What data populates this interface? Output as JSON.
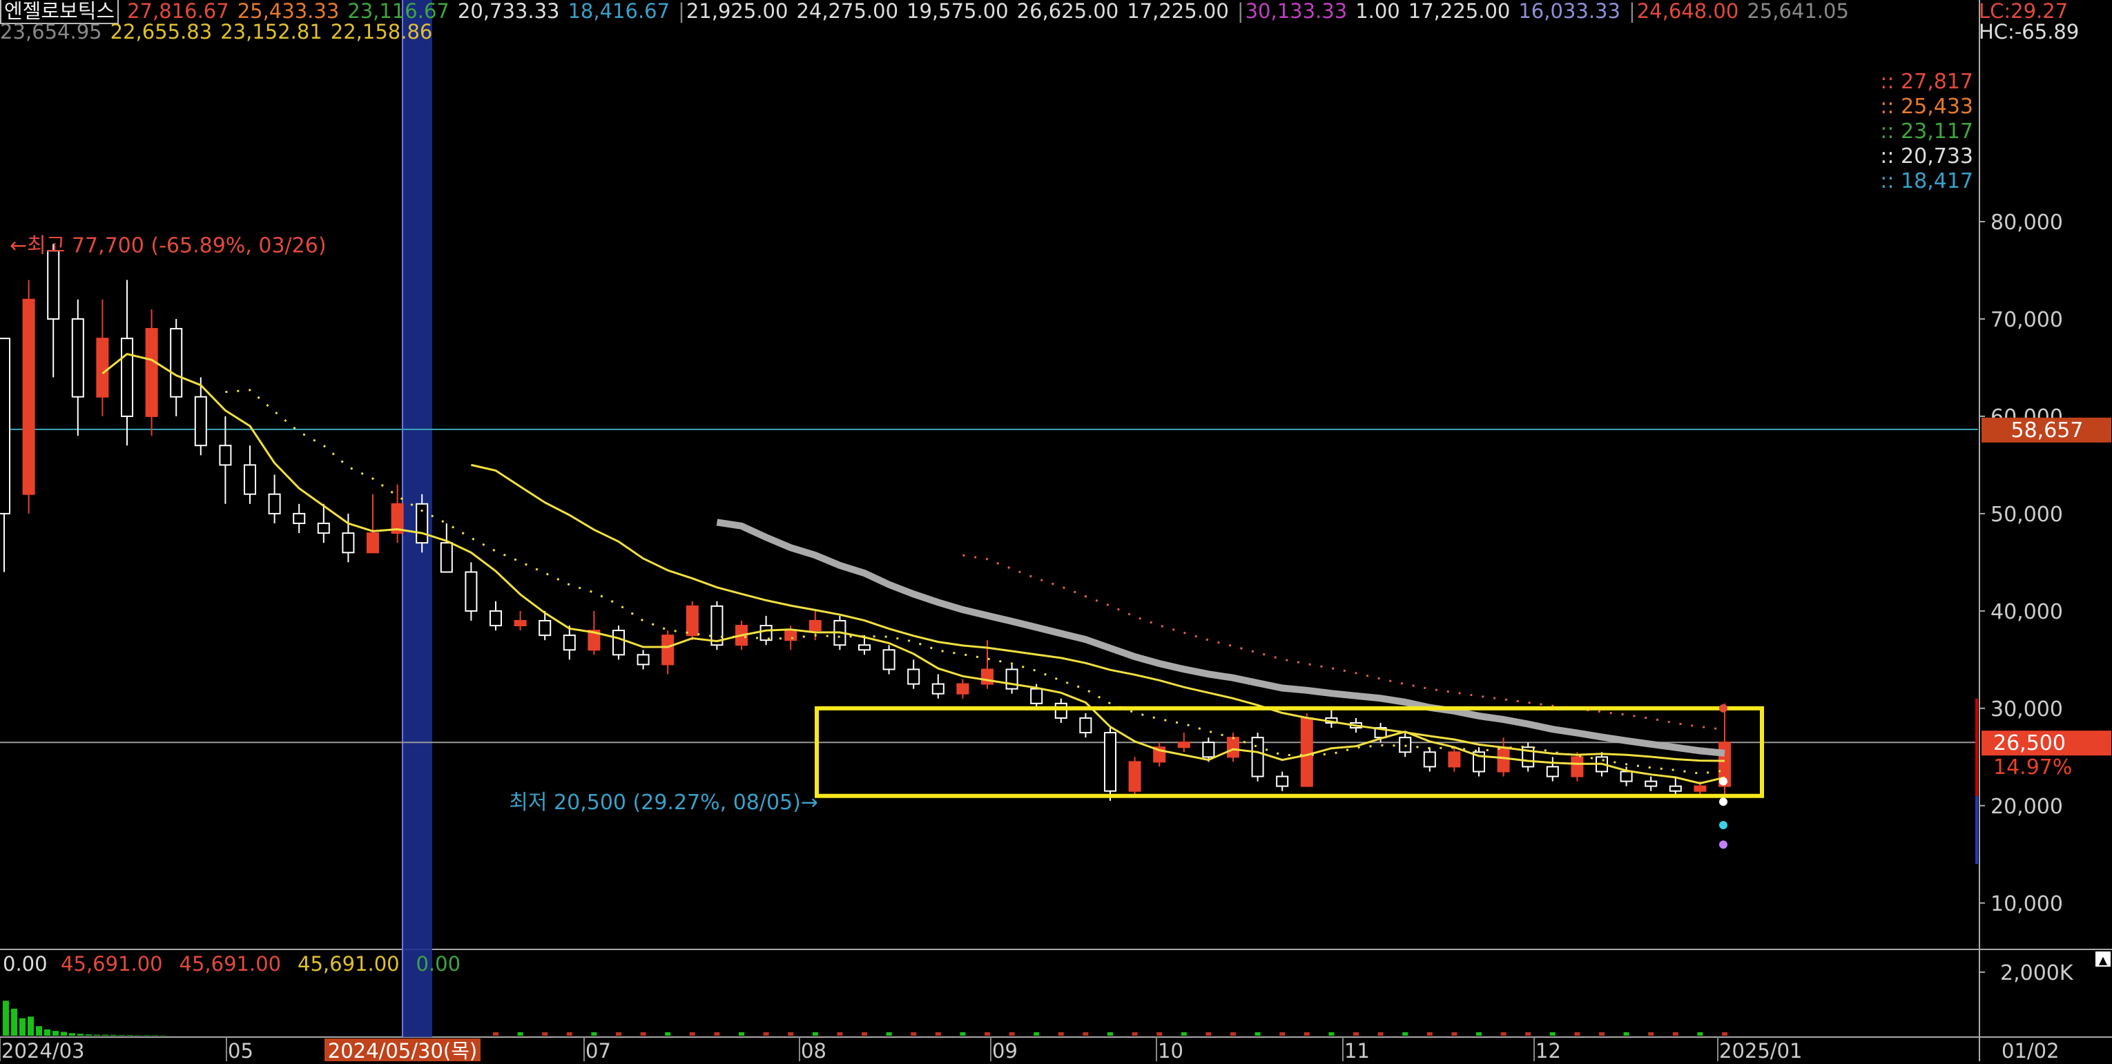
{
  "header": {
    "stock_name": "엔젤로보틱스",
    "row1_groups": [
      {
        "values": [
          "27,816.67",
          "25,433.33",
          "23,116.67",
          "20,733.33",
          "18,416.67"
        ],
        "colors": [
          "#e24a3a",
          "#e87a2a",
          "#3fa53f",
          "#dddddd",
          "#3aa0c8"
        ]
      },
      {
        "values": [
          "21,925.00",
          "24,275.00",
          "19,575.00",
          "26,625.00",
          "17,225.00"
        ],
        "colors": [
          "#dddddd",
          "#dddddd",
          "#dddddd",
          "#dddddd",
          "#dddddd"
        ]
      },
      {
        "values": [
          "30,133.33",
          "1.00",
          "17,225.00",
          "16,033.33"
        ],
        "colors": [
          "#c040c0",
          "#dddddd",
          "#dddddd",
          "#8f8fd8"
        ]
      },
      {
        "values": [
          "24,648.00",
          "25,641.05"
        ],
        "colors": [
          "#e24a3a",
          "#888888"
        ]
      }
    ],
    "row2_values": [
      "23,654.95",
      "22,655.83",
      "23,152.81",
      "22,158.86"
    ],
    "row2_colors": [
      "#888888",
      "#e0c030",
      "#e0c030",
      "#e0c030"
    ],
    "lc_label": "LC:29.27",
    "hc_label": "HC:-65.89"
  },
  "colors": {
    "up": "#e8412a",
    "down": "#ffffff",
    "ma_yellow": "#f0e040",
    "highlight_box": "#f7e81c",
    "hline_cyan": "#3aa7b8",
    "price_tag": "#c0431c",
    "current_tag": "#e8412a",
    "selection": "#1c2e8c"
  },
  "chart_data": {
    "type": "candlestick",
    "title": "",
    "xlabel": "",
    "ylabel": "",
    "ylim": [
      8000,
      90000
    ],
    "y_ticks": [
      "10,000",
      "20,000",
      "30,000",
      "40,000",
      "50,000",
      "60,000",
      "70,000",
      "80,000"
    ],
    "x_tick_labels": [
      "2024/03",
      "05",
      "07",
      "08",
      "09",
      "10",
      "11",
      "12",
      "2025/01"
    ],
    "selected_date": "2024/05/30(목)",
    "right_axis_date": "01/02",
    "annotations": {
      "high": "최고 77,700 (-65.89%, 03/26)",
      "low": "최저 20,500 (29.27%, 08/05)"
    },
    "legend_values": [
      "27,817",
      "25,433",
      "23,117",
      "20,733",
      "18,417"
    ],
    "legend_colors": [
      "#e24a3a",
      "#e87a2a",
      "#3fa53f",
      "#dddddd",
      "#3aa0c8"
    ],
    "price_tag": "58,657",
    "current_price": "26,500",
    "current_change": "14.97%",
    "horizontal_lines": [
      58657,
      26500
    ],
    "highlight_box": {
      "y_top": 30000,
      "y_bottom": 21000,
      "date_start": "08/05",
      "date_end": "2025/01"
    },
    "candles_ohlc_estimated": [
      [
        68000,
        68000,
        44000,
        50000
      ],
      [
        52000,
        74000,
        50000,
        72000
      ],
      [
        77000,
        77700,
        64000,
        70000
      ],
      [
        70000,
        72000,
        58000,
        62000
      ],
      [
        62000,
        72000,
        60000,
        68000
      ],
      [
        68000,
        74000,
        57000,
        60000
      ],
      [
        60000,
        71000,
        58000,
        69000
      ],
      [
        69000,
        70000,
        60000,
        62000
      ],
      [
        62000,
        64000,
        56000,
        57000
      ],
      [
        57000,
        60000,
        51000,
        55000
      ],
      [
        55000,
        57000,
        51000,
        52000
      ],
      [
        52000,
        54000,
        49000,
        50000
      ],
      [
        50000,
        51000,
        48000,
        49000
      ],
      [
        49000,
        51000,
        47000,
        48000
      ],
      [
        48000,
        50000,
        45000,
        46000
      ],
      [
        46000,
        52000,
        46000,
        48000
      ],
      [
        48000,
        53000,
        47000,
        51000
      ],
      [
        51000,
        52000,
        46000,
        47000
      ],
      [
        47000,
        49000,
        44000,
        44000
      ],
      [
        44000,
        45000,
        39000,
        40000
      ],
      [
        40000,
        41000,
        38000,
        38500
      ],
      [
        38500,
        40000,
        38000,
        39000
      ],
      [
        39000,
        40000,
        37000,
        37500
      ],
      [
        37500,
        38500,
        35000,
        36000
      ],
      [
        36000,
        40000,
        35500,
        38000
      ],
      [
        38000,
        38500,
        35000,
        35500
      ],
      [
        35500,
        36000,
        34000,
        34500
      ],
      [
        34500,
        38000,
        33500,
        37500
      ],
      [
        37500,
        41000,
        37000,
        40500
      ],
      [
        40500,
        41000,
        36000,
        36500
      ],
      [
        36500,
        39000,
        36000,
        38500
      ],
      [
        38500,
        39500,
        36500,
        37000
      ],
      [
        37000,
        38500,
        36000,
        38000
      ],
      [
        38000,
        40000,
        37000,
        39000
      ],
      [
        39000,
        39500,
        36000,
        36500
      ],
      [
        36500,
        37500,
        35500,
        36000
      ],
      [
        36000,
        36500,
        33500,
        34000
      ],
      [
        34000,
        35000,
        32000,
        32500
      ],
      [
        32500,
        33500,
        31000,
        31500
      ],
      [
        31500,
        33000,
        31000,
        32500
      ],
      [
        32500,
        37000,
        32000,
        34000
      ],
      [
        34000,
        34500,
        31500,
        32000
      ],
      [
        32000,
        32500,
        30000,
        30500
      ],
      [
        30500,
        31000,
        28500,
        29000
      ],
      [
        29000,
        29500,
        27000,
        27500
      ],
      [
        27500,
        28000,
        20500,
        21500
      ],
      [
        21500,
        25000,
        21000,
        24500
      ],
      [
        24500,
        26500,
        24000,
        26000
      ],
      [
        26000,
        27500,
        25500,
        26500
      ],
      [
        26500,
        27000,
        24500,
        25000
      ],
      [
        25000,
        27500,
        24500,
        27000
      ],
      [
        27000,
        27500,
        22500,
        23000
      ],
      [
        23000,
        23500,
        21500,
        22000
      ],
      [
        22000,
        29500,
        22000,
        29000
      ],
      [
        29000,
        30000,
        28000,
        28500
      ],
      [
        28500,
        29000,
        27500,
        28000
      ],
      [
        28000,
        28500,
        26500,
        27000
      ],
      [
        27000,
        27500,
        25000,
        25500
      ],
      [
        25500,
        26000,
        23500,
        24000
      ],
      [
        24000,
        26000,
        23500,
        25500
      ],
      [
        25500,
        26000,
        23000,
        23500
      ],
      [
        23500,
        27000,
        23000,
        26000
      ],
      [
        26000,
        26500,
        23500,
        24000
      ],
      [
        24000,
        25000,
        22500,
        23000
      ],
      [
        23000,
        25500,
        22500,
        25000
      ],
      [
        25000,
        25500,
        23000,
        23500
      ],
      [
        23500,
        24000,
        22000,
        22500
      ],
      [
        22500,
        23000,
        21500,
        22000
      ],
      [
        22000,
        23000,
        21000,
        21500
      ],
      [
        21500,
        22500,
        21000,
        22000
      ],
      [
        22000,
        30500,
        21000,
        26500
      ]
    ],
    "volume": {
      "ylabel": "2,000K",
      "legend_values": [
        "0.00",
        "45,691.00",
        "45,691.00",
        "45,691.00",
        "0.00"
      ],
      "legend_colors": [
        "#dddddd",
        "#e24a3a",
        "#e24a3a",
        "#e0c030",
        "#3fa53f"
      ],
      "bars_k_estimated": [
        1100,
        850,
        550,
        600,
        300,
        200,
        150,
        120,
        80,
        60,
        40,
        30,
        30,
        25,
        20,
        20,
        15,
        15,
        15,
        10
      ]
    }
  }
}
